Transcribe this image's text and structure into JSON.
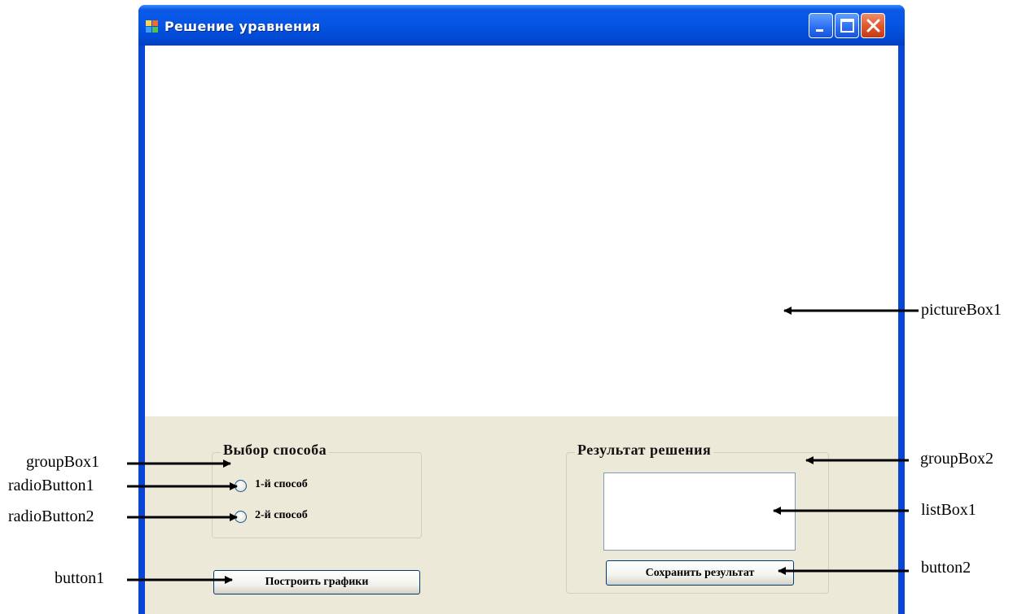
{
  "window": {
    "title": "Решение уравнения",
    "controls": [
      "minimize-icon",
      "maximize-icon",
      "close-icon"
    ]
  },
  "group1": {
    "title": "Выбор способа",
    "radio1_label": "1-й способ",
    "radio2_label": "2-й способ"
  },
  "button1_label": "Построить графики",
  "group2": {
    "title": "Результат решения",
    "listbox_items": []
  },
  "button2_label": "Сохранить результат",
  "annotations": {
    "picturebox": "pictureBox1",
    "groupbox1": "groupBox1",
    "radiobutton1": "radioButton1",
    "radiobutton2": "radioButton2",
    "button1": "button1",
    "groupbox2": "groupBox2",
    "listbox1": "listBox1",
    "button2": "button2"
  },
  "colors": {
    "titlebar": "#0554e4",
    "client_bg": "#ece9d8",
    "close_button": "#e05a30"
  }
}
